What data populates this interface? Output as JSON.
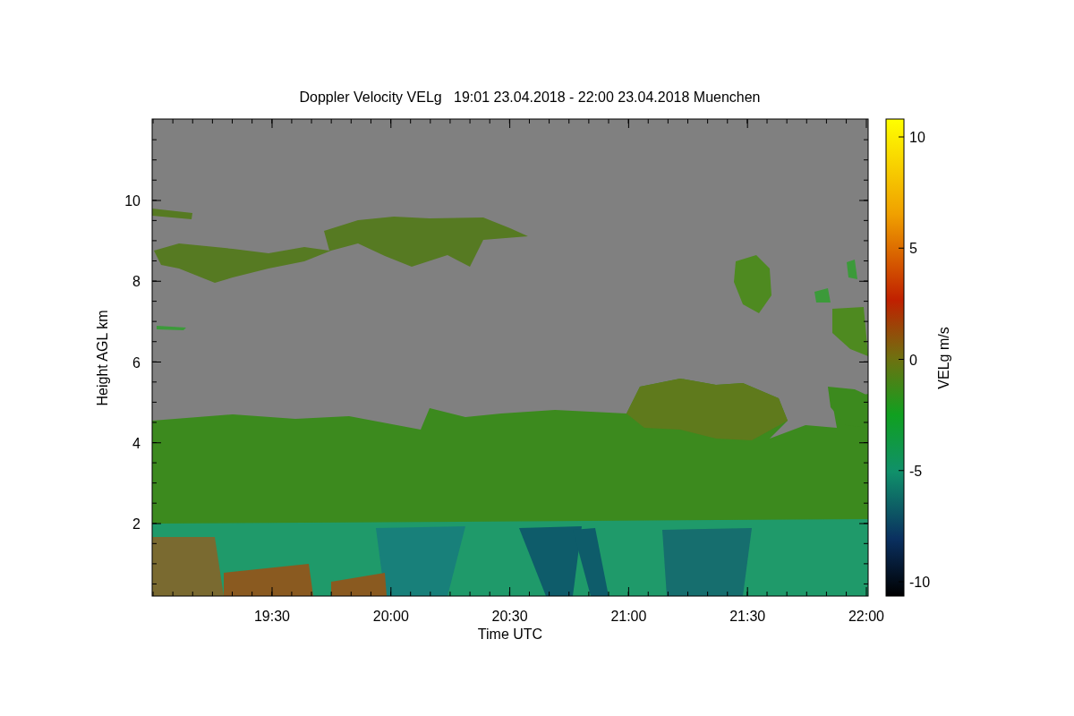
{
  "title": "Doppler Velocity VELg   19:01 23.04.2018 - 22:00 23.04.2018 Muenchen",
  "plot": {
    "ylabel": "Height AGL km",
    "yticks": [
      "10",
      "8",
      "6",
      "4",
      "2"
    ],
    "xlabel": "Time UTC",
    "xticks": [
      "19:30",
      "20:00",
      "20:30",
      "21:00",
      "21:30",
      "22:00"
    ]
  },
  "colorbar": {
    "label": "VELg m/s",
    "ticks": [
      "10",
      "5",
      "0",
      "-5",
      "-10"
    ]
  }
}
